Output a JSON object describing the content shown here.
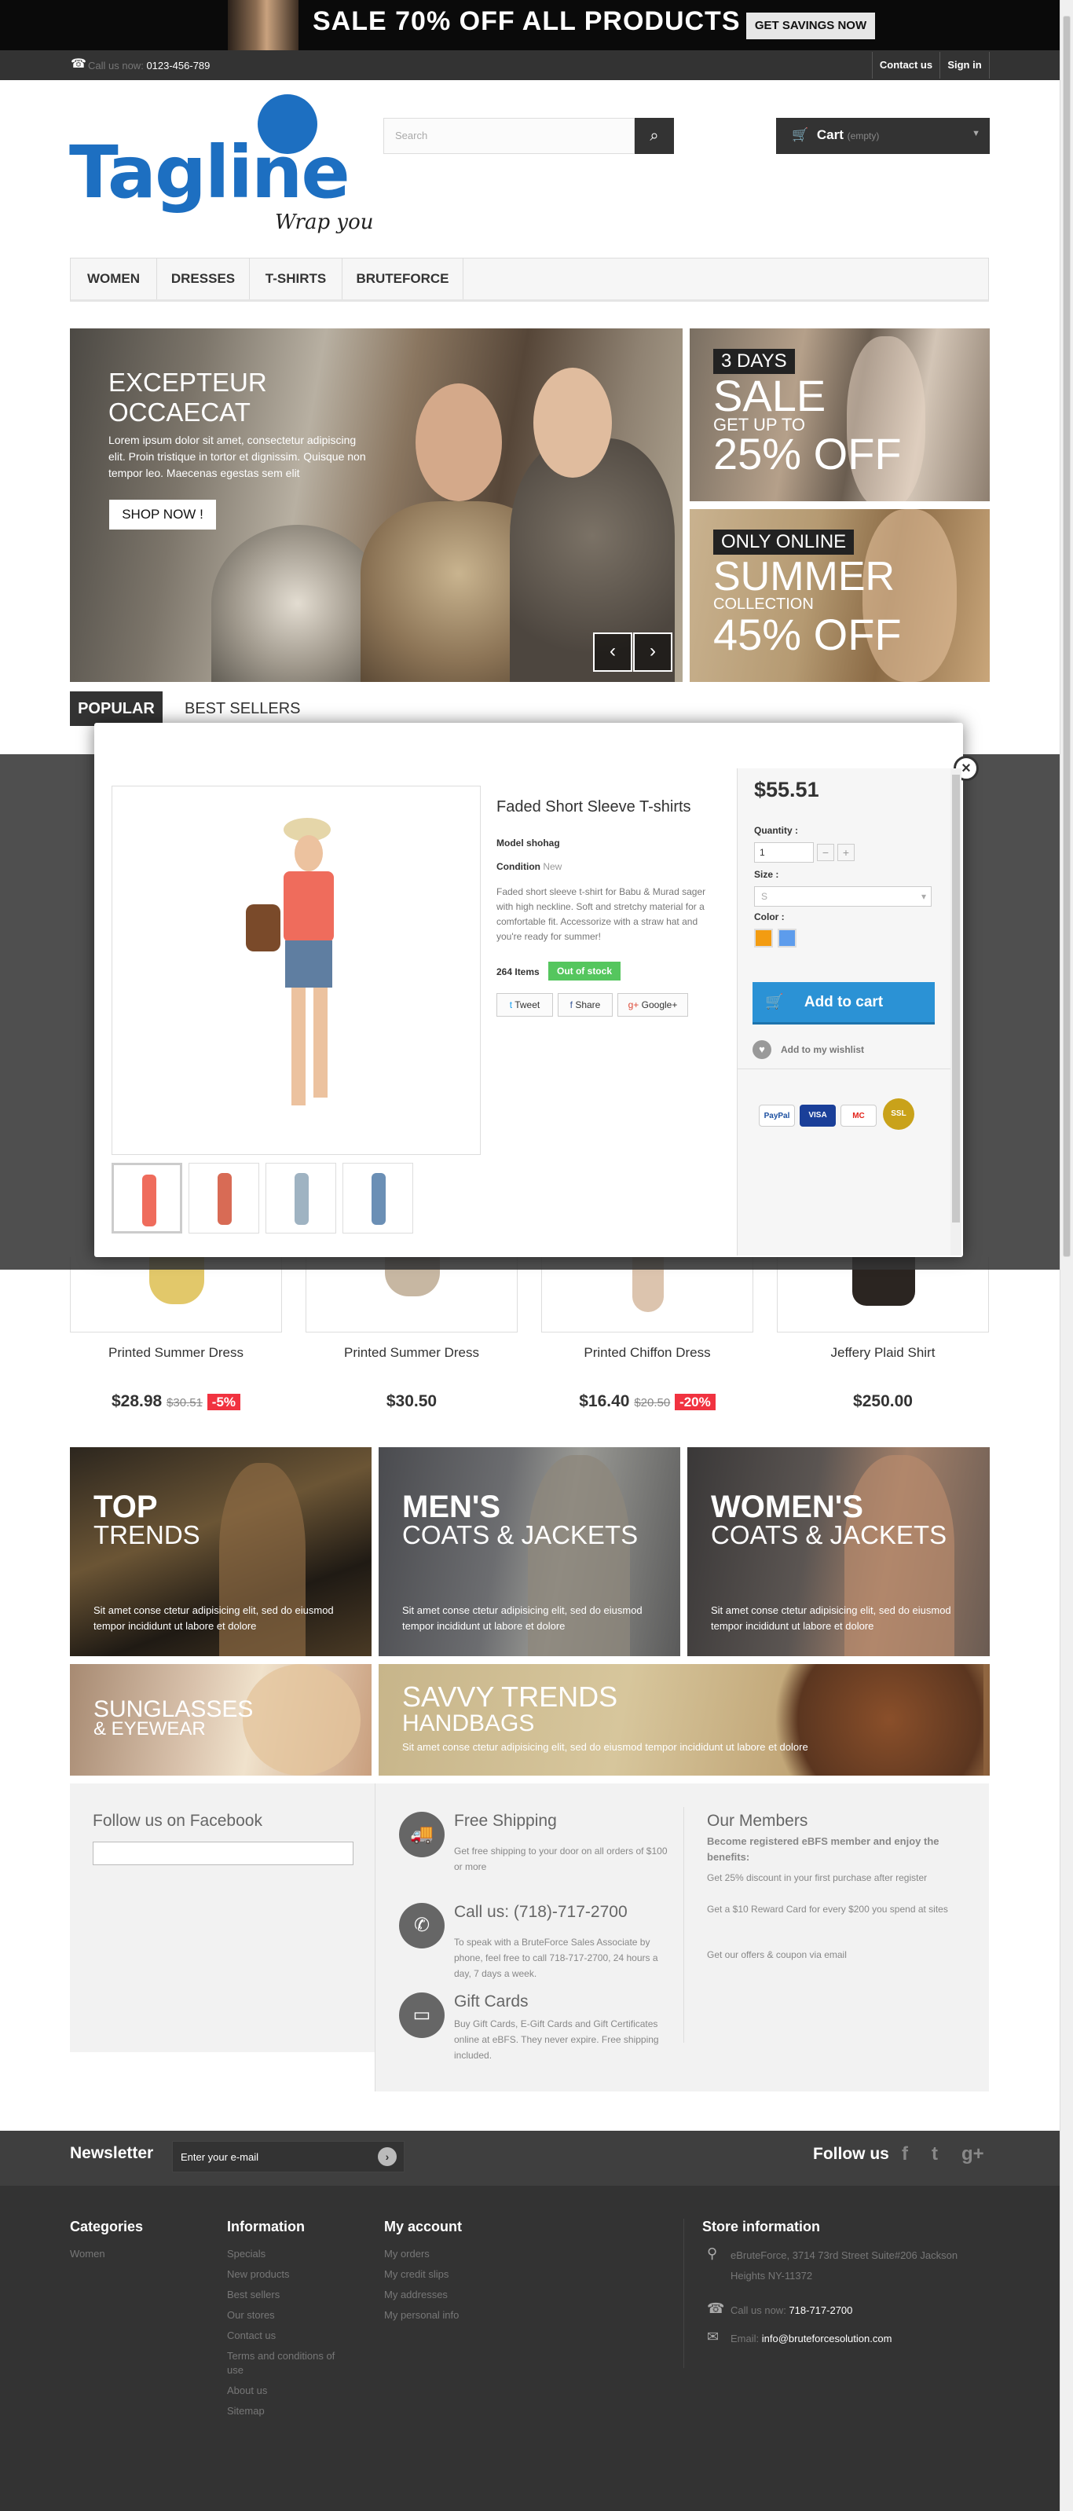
{
  "top_banner": {
    "sale_text": "SALE 70% OFF ALL PRODUCTS",
    "cta": "GET SAVINGS NOW"
  },
  "top_nav": {
    "call_label": "Call us now:",
    "phone": "0123-456-789",
    "contact": "Contact us",
    "signin": "Sign in"
  },
  "header": {
    "logo": "Tagline",
    "logo_tagline": "Wrap you",
    "search_placeholder": "Search",
    "cart_label": "Cart",
    "cart_state": "(empty)"
  },
  "menu": [
    "WOMEN",
    "DRESSES",
    "T-SHIRTS",
    "BRUTEFORCE"
  ],
  "hero": {
    "heading_1": "EXCEPTEUR",
    "heading_2": "OCCAECAT",
    "text": "Lorem ipsum dolor sit amet, consectetur adipiscing elit. Proin tristique in tortor et dignissim. Quisque non tempor leo. Maecenas egestas sem elit",
    "button": "SHOP NOW !",
    "prev": "‹",
    "next": "›"
  },
  "side_banners": [
    {
      "tag": "3 DAYS",
      "line1": "SALE",
      "line2": "GET UP TO",
      "line3": "25% OFF"
    },
    {
      "tag": "ONLY ONLINE",
      "line1": "SUMMER",
      "line2": "COLLECTION",
      "line3": "45% OFF"
    }
  ],
  "tabs": {
    "popular": "POPULAR",
    "best": "BEST SELLERS"
  },
  "quickview": {
    "close": "×",
    "title": "Faded Short Sleeve T-shirts",
    "model_label": "Model",
    "model_value": "shohag",
    "condition_label": "Condition",
    "condition_value": "New",
    "description": "Faded short sleeve t-shirt for Babu & Murad sager with high neckline. Soft and stretchy material for a comfortable fit. Accessorize with a straw hat and you're ready for summer!",
    "items": "264 Items",
    "stock": "Out of stock",
    "share": [
      "Tweet",
      "Share",
      "Google+"
    ],
    "price": "$55.51",
    "quantity_label": "Quantity :",
    "quantity": "1",
    "qty_minus": "−",
    "qty_plus": "+",
    "size_label": "Size :",
    "size": "S",
    "color_label": "Color :",
    "colors": [
      "#f39c11",
      "#5d9cec"
    ],
    "add_to_cart": "Add to cart",
    "wishlist": "Add to my wishlist",
    "payments": [
      "PayPal",
      "VISA",
      "MC",
      "SSL"
    ]
  },
  "products": [
    {
      "name": "Printed Summer Dress",
      "price": "$28.98",
      "old": "$30.51",
      "discount": "-5%"
    },
    {
      "name": "Printed Summer Dress",
      "price": "$30.50",
      "old": "",
      "discount": ""
    },
    {
      "name": "Printed Chiffon Dress",
      "price": "$16.40",
      "old": "$20.50",
      "discount": "-20%"
    },
    {
      "name": "Jeffery Plaid Shirt",
      "price": "$250.00",
      "old": "",
      "discount": ""
    }
  ],
  "promos": [
    {
      "h1": "TOP",
      "h2": "TRENDS",
      "text": "Sit amet conse ctetur adipisicing elit, sed do eiusmod tempor incididunt ut labore et dolore"
    },
    {
      "h1": "MEN'S",
      "h2": "COATS & JACKETS",
      "text": "Sit amet conse ctetur adipisicing elit, sed do eiusmod tempor incididunt ut labore et dolore"
    },
    {
      "h1": "WOMEN'S",
      "h2": "COATS & JACKETS",
      "text": "Sit amet conse ctetur adipisicing elit, sed do eiusmod tempor incididunt ut labore et dolore"
    },
    {
      "h1": "SUNGLASSES",
      "h2": "& EYEWEAR",
      "text": ""
    },
    {
      "h1": "SAVVY TRENDS",
      "h2": "HANDBAGS",
      "text": "Sit amet conse ctetur adipisicing elit, sed do eiusmod tempor incididunt ut labore et dolore"
    }
  ],
  "facebook": {
    "title": "Follow us on Facebook"
  },
  "info": [
    {
      "icon": "truck-icon",
      "title": "Free Shipping",
      "text": "Get free shipping to your door on all orders of $100 or more"
    },
    {
      "icon": "phone-icon",
      "title": "Call us: (718)-717-2700",
      "text": "To speak with a BruteForce Sales Associate by phone, feel free to call 718-717-2700, 24 hours a day, 7 days a week."
    },
    {
      "icon": "card-icon",
      "title": "Gift Cards",
      "text": "Buy Gift Cards, E-Gift Cards and Gift Certificates online at eBFS. They never expire. Free shipping included."
    }
  ],
  "members": {
    "title": "Our Members",
    "lead": "Become registered eBFS member and enjoy the benefits:",
    "items": [
      "Get 25% discount in your first purchase after register",
      "Get a $10 Reward Card for every $200 you spend at sites",
      "Get our offers & coupon via email"
    ]
  },
  "newsletter": {
    "title": "Newsletter",
    "placeholder": "Enter your e-mail",
    "go": "›",
    "follow": "Follow us",
    "social": [
      "f",
      "t",
      "g+"
    ]
  },
  "footer": {
    "categories": {
      "title": "Categories",
      "links": [
        "Women"
      ]
    },
    "information": {
      "title": "Information",
      "links": [
        "Specials",
        "New products",
        "Best sellers",
        "Our stores",
        "Contact us",
        "Terms and conditions of use",
        "About us",
        "Sitemap"
      ]
    },
    "account": {
      "title": "My account",
      "links": [
        "My orders",
        "My credit slips",
        "My addresses",
        "My personal info"
      ]
    },
    "store": {
      "title": "Store information",
      "address": "eBruteForce, 3714 73rd Street Suite#206 Jackson Heights NY-11372",
      "call_label": "Call us now:",
      "phone": "718-717-2700",
      "email_label": "Email:",
      "email": "info@bruteforcesolution.com"
    }
  }
}
